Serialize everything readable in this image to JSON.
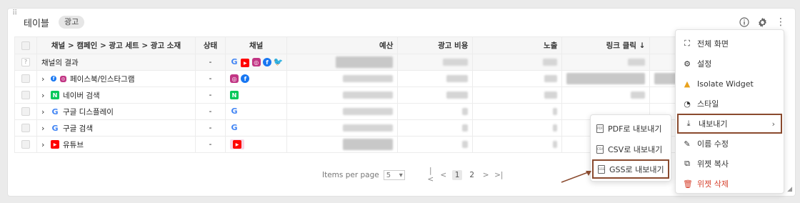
{
  "widget": {
    "title": "테이블",
    "chip": "광고"
  },
  "header_icons": {
    "info": "info-icon",
    "settings": "gear-icon",
    "more": "more-vertical-icon"
  },
  "table": {
    "columns": [
      "",
      "채널 > 캠페인 > 광고 세트 > 광고 소재",
      "상태",
      "채널",
      "예산",
      "광고 비용",
      "노출",
      "링크 클릭 ↓"
    ],
    "total_row": {
      "name": "채널의 결과",
      "status": "-"
    },
    "rows": [
      {
        "name": "페이스북/인스타그램",
        "status": "-"
      },
      {
        "name": "네이버 검색",
        "status": "-"
      },
      {
        "name": "구글 디스플레이",
        "status": "-"
      },
      {
        "name": "구글 검색",
        "status": "-"
      },
      {
        "name": "유튜브",
        "status": "-"
      }
    ]
  },
  "pager": {
    "items_label": "Items per page",
    "per_page": "5",
    "pages": [
      "1",
      "2"
    ],
    "first": "|<",
    "prev": "<",
    "next": ">",
    "last": ">|"
  },
  "menu": {
    "items": [
      {
        "label": "전체 화면",
        "icon": "fullscreen-icon"
      },
      {
        "label": "설정",
        "icon": "gear-icon"
      },
      {
        "label": "Isolate Widget",
        "icon": "warning-icon"
      },
      {
        "label": "스타일",
        "icon": "palette-icon"
      },
      {
        "label": "내보내기",
        "icon": "download-icon"
      },
      {
        "label": "이름 수정",
        "icon": "rename-icon"
      },
      {
        "label": "위젯 복사",
        "icon": "copy-icon"
      },
      {
        "label": "위젯 삭제",
        "icon": "trash-icon"
      }
    ]
  },
  "submenu": {
    "items": [
      {
        "label": "PDF로 내보내기",
        "icon": "pdf-file-icon",
        "tag": "PDF"
      },
      {
        "label": "CSV로 내보내기",
        "icon": "csv-file-icon",
        "tag": "CSV"
      },
      {
        "label": "GSS로 내보내기",
        "icon": "gss-file-icon",
        "tag": "GSS"
      }
    ]
  },
  "colors": {
    "highlight_border": "#8a4a2e",
    "delete": "#d6402c",
    "warning": "#e9a21d"
  }
}
